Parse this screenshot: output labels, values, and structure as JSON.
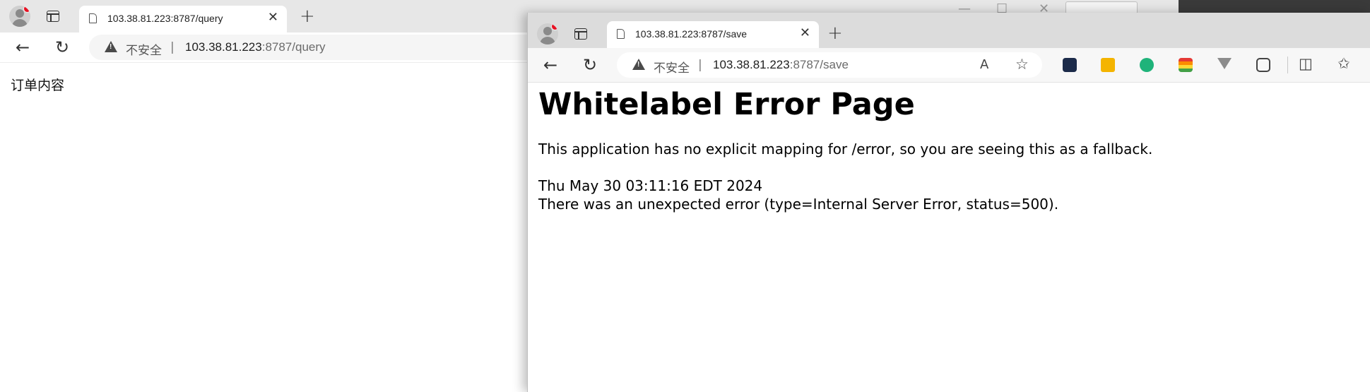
{
  "back_window": {
    "tab_title": "103.38.81.223:8787/query",
    "insecure_label": "不安全",
    "separator": "|",
    "url_host": "103.38.81.223",
    "url_path": ":8787/query",
    "page_text": "订单内容"
  },
  "front_window": {
    "tab_title": "103.38.81.223:8787/save",
    "insecure_label": "不安全",
    "separator": "|",
    "url_host": "103.38.81.223",
    "url_path": ":8787/save",
    "error_heading": "Whitelabel Error Page",
    "error_message": "This application has no explicit mapping for /error, so you are seeing this as a fallback.",
    "timestamp": "Thu May 30 03:11:16 EDT 2024",
    "error_detail": "There was an unexpected error (type=Internal Server Error, status=500)."
  },
  "icons": {
    "back": "←",
    "refresh": "↻",
    "close": "✕",
    "new_tab": "+",
    "read_aloud": "A",
    "favorite": "☆",
    "split_screen": "◫",
    "favorites_bar": "✩",
    "minimize": "—",
    "maximize": "☐"
  },
  "colors": {
    "profile_badge": "#e81123",
    "ext_green": "#1fb37a",
    "ext_yellow": "#f4b400",
    "ext_dark": "#1c2b4a"
  }
}
